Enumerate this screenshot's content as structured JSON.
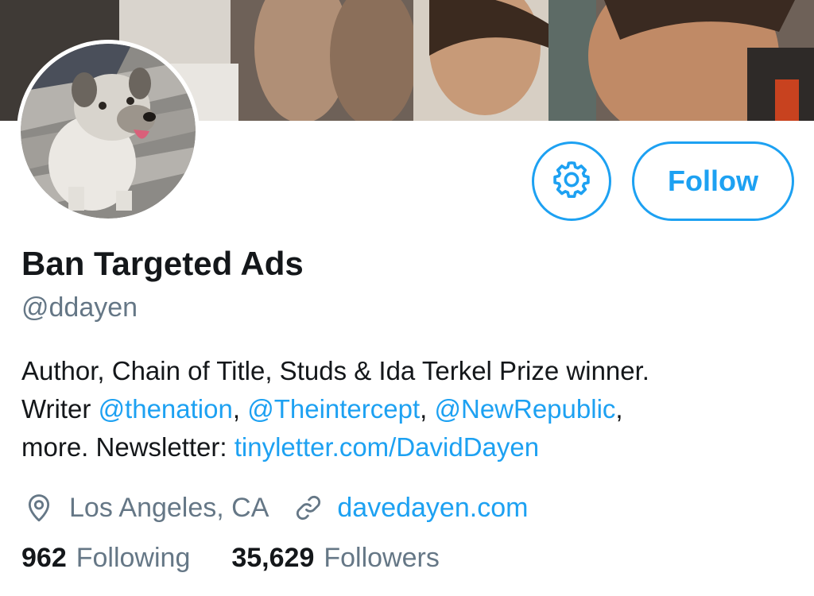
{
  "profile": {
    "display_name": "Ban Targeted Ads",
    "handle": "@ddayen",
    "bio": {
      "line1": "Author, Chain of Title, Studs & Ida Terkel Prize winner.",
      "line2_prefix": "Writer ",
      "mention1": "@thenation",
      "sep1": ", ",
      "mention2": "@Theintercept",
      "sep2": ", ",
      "mention3": "@NewRepublic",
      "line2_suffix": ",",
      "line3_prefix": "more. Newsletter: ",
      "newsletter_link": "tinyletter.com/DavidDayen"
    },
    "location": "Los Angeles, CA",
    "website": "davedayen.com",
    "following_count": "962",
    "following_label": "Following",
    "followers_count": "35,629",
    "followers_label": "Followers"
  },
  "actions": {
    "follow_label": "Follow"
  },
  "icons": {
    "settings": "gear-icon",
    "location": "location-pin-icon",
    "website": "link-icon"
  },
  "colors": {
    "accent": "#1da1f2",
    "primary_text": "#14171a",
    "secondary_text": "#657786"
  }
}
